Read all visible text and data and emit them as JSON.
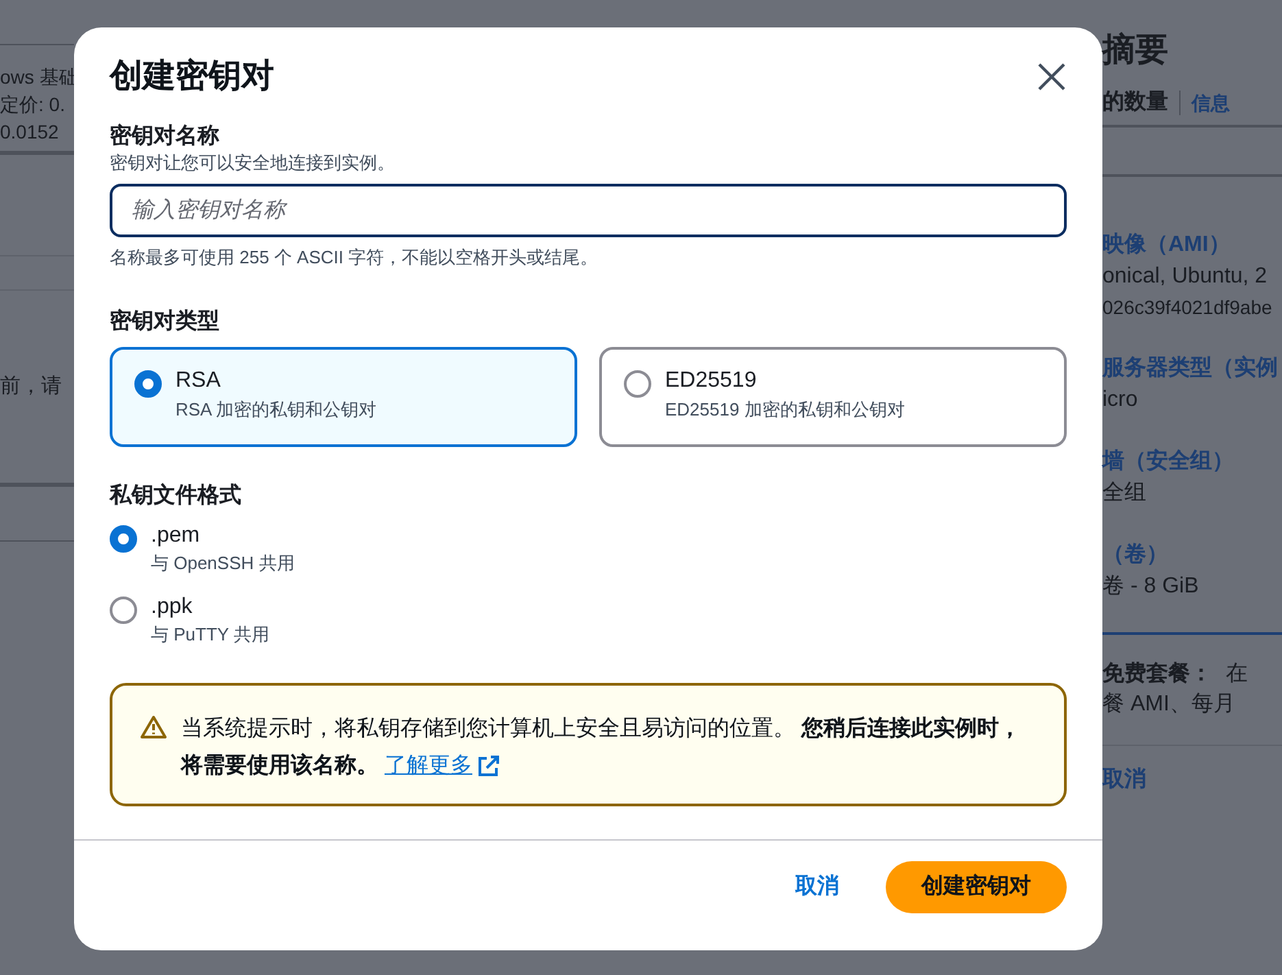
{
  "background": {
    "left_texts": [
      "ows 基础",
      "定价: 0.",
      "0.0152",
      "前，请"
    ],
    "summary": {
      "title": "摘要",
      "count_label": "的数量",
      "info_link": "信息",
      "sections": [
        {
          "heading": "映像（AMI）",
          "lines": [
            "onical, Ubuntu, 2",
            "026c39f4021df9abe"
          ]
        },
        {
          "heading": "服务器类型（实例",
          "lines": [
            "icro"
          ]
        },
        {
          "heading": "墙（安全组）",
          "lines": [
            "全组"
          ]
        },
        {
          "heading": "（卷）",
          "lines": [
            "卷 - 8 GiB"
          ]
        }
      ],
      "free_tier": {
        "label": "免费套餐：",
        "text": "在",
        "line2": "餐 AMI、每月"
      },
      "cancel": "取消"
    }
  },
  "dialog": {
    "title": "创建密钥对",
    "name_field": {
      "label": "密钥对名称",
      "description": "密钥对让您可以安全地连接到实例。",
      "placeholder": "输入密钥对名称",
      "hint": "名称最多可使用 255 个 ASCII 字符，不能以空格开头或结尾。"
    },
    "key_type": {
      "label": "密钥对类型",
      "options": [
        {
          "title": "RSA",
          "description": "RSA 加密的私钥和公钥对",
          "selected": true
        },
        {
          "title": "ED25519",
          "description": "ED25519 加密的私钥和公钥对",
          "selected": false
        }
      ]
    },
    "file_format": {
      "label": "私钥文件格式",
      "options": [
        {
          "title": ".pem",
          "description": "与 OpenSSH 共用",
          "selected": true
        },
        {
          "title": ".ppk",
          "description": "与 PuTTY 共用",
          "selected": false
        }
      ]
    },
    "alert": {
      "text": "当系统提示时，将私钥存储到您计算机上安全且易访问的位置。 **您稍后连接此实例时，将需要使用该名称。**",
      "link": "了解更多"
    },
    "buttons": {
      "cancel": "取消",
      "create": "创建密钥对"
    }
  }
}
